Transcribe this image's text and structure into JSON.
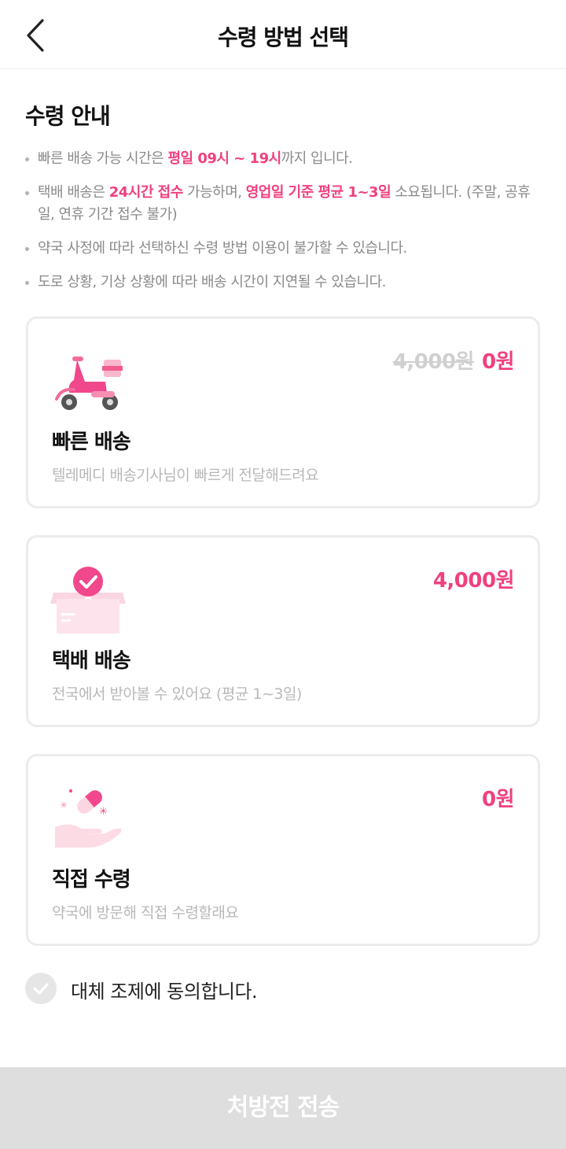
{
  "header": {
    "title": "수령 방법 선택",
    "back_icon": "chevron-left-icon"
  },
  "notice": {
    "title": "수령 안내",
    "items": [
      {
        "parts": [
          {
            "text": "빠른 배송 가능 시간은 "
          },
          {
            "text": "평일 09시 ~ 19시",
            "highlight": true
          },
          {
            "text": "까지 입니다."
          }
        ]
      },
      {
        "parts": [
          {
            "text": "택배 배송은 "
          },
          {
            "text": "24시간 접수",
            "highlight": true
          },
          {
            "text": " 가능하며, "
          },
          {
            "text": "영업일 기준 평균 1~3일",
            "highlight": true
          },
          {
            "text": " 소요됩니다. (주말, 공휴일, 연휴 기간 접수 불가)"
          }
        ]
      },
      {
        "parts": [
          {
            "text": "약국 사정에 따라 선택하신 수령 방법 이용이 불가할 수 있습니다."
          }
        ]
      },
      {
        "parts": [
          {
            "text": "도로 상황, 기상 상황에 따라 배송 시간이 지연될 수 있습니다."
          }
        ]
      }
    ]
  },
  "options": [
    {
      "title": "빠른 배송",
      "description": "텔레메디 배송기사님이 빠르게 전달해드려요",
      "original_price": "4,000원",
      "price": "0원",
      "icon": "scooter-icon"
    },
    {
      "title": "택배 배송",
      "description": "전국에서 받아볼 수 있어요 (평균 1~3일)",
      "price": "4,000원",
      "icon": "parcel-box-icon"
    },
    {
      "title": "직접 수령",
      "description": "약국에 방문해 직접 수령할래요",
      "price": "0원",
      "icon": "pill-hand-icon"
    }
  ],
  "agreement": {
    "label": "대체 조제에 동의합니다.",
    "checked": false
  },
  "submit": {
    "label": "처방전 전송",
    "enabled": false
  },
  "colors": {
    "accent": "#f04080",
    "disabled_button": "#dedede",
    "card_border": "#ececec"
  }
}
